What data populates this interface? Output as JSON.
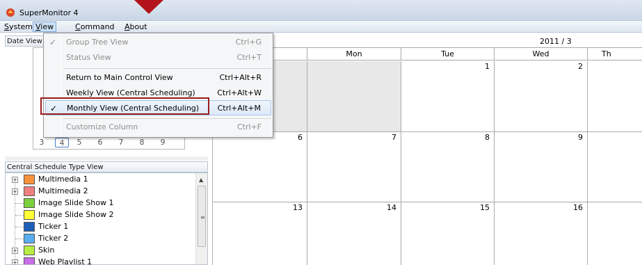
{
  "window": {
    "title": "SuperMonitor 4"
  },
  "menubar": [
    {
      "label": "System",
      "accel": "S",
      "rest": "ystem"
    },
    {
      "label": "View",
      "accel": "V",
      "rest": "iew"
    },
    {
      "label": "Command",
      "accel": "C",
      "rest": "ommand"
    },
    {
      "label": "About",
      "accel": "A",
      "rest": "bout"
    }
  ],
  "view_menu": {
    "items": [
      {
        "label": "Group Tree View",
        "shortcut": "Ctrl+G",
        "checked": true,
        "check": "✓",
        "disabled": true
      },
      {
        "label": "Status View",
        "shortcut": "Ctrl+T",
        "checked": false,
        "disabled": true
      },
      {
        "label": "Return to Main Control View",
        "shortcut": "Ctrl+Alt+R",
        "checked": false,
        "disabled": false
      },
      {
        "label": "Weekly View (Central Scheduling)",
        "shortcut": "Ctrl+Alt+W",
        "checked": false,
        "disabled": false
      },
      {
        "label": "Monthly View (Central Scheduling)",
        "shortcut": "Ctrl+Alt+M",
        "checked": true,
        "check": "✓",
        "disabled": false
      },
      {
        "label": "Customize Column",
        "shortcut": "Ctrl+F",
        "checked": false,
        "disabled": true
      }
    ]
  },
  "left_pane": {
    "date_view_header": "Date View",
    "mini_calendar_row": [
      "3",
      "4",
      "5",
      "6",
      "7",
      "8",
      "9"
    ],
    "schedule_type_header": "Central Schedule Type View",
    "schedule_types": [
      {
        "label": "Multimedia 1",
        "color": "#f7923a",
        "expandable": true
      },
      {
        "label": "Multimedia 2",
        "color": "#f08080",
        "expandable": true
      },
      {
        "label": "Image Slide Show 1",
        "color": "#7cd03b",
        "expandable": false
      },
      {
        "label": "Image Slide Show 2",
        "color": "#ffff33",
        "expandable": false
      },
      {
        "label": "Ticker 1",
        "color": "#1f5fb8",
        "expandable": false
      },
      {
        "label": "Ticker 2",
        "color": "#58aef0",
        "expandable": false
      },
      {
        "label": "Skin",
        "color": "#b8ee44",
        "expandable": true
      },
      {
        "label": "Web Playlist 1",
        "color": "#c86ee6",
        "expandable": true
      }
    ]
  },
  "calendar": {
    "month_label": "2011 / 3",
    "weekdays": [
      "",
      "Mon",
      "Tue",
      "Wed",
      "Th"
    ],
    "weeks": [
      [
        "",
        "",
        "1",
        "2",
        ""
      ],
      [
        "6",
        "7",
        "8",
        "9",
        ""
      ],
      [
        "13",
        "14",
        "15",
        "16",
        ""
      ]
    ]
  },
  "colors": {
    "highlight_border": "#9a1b1e",
    "pointer": "#b3141b"
  }
}
